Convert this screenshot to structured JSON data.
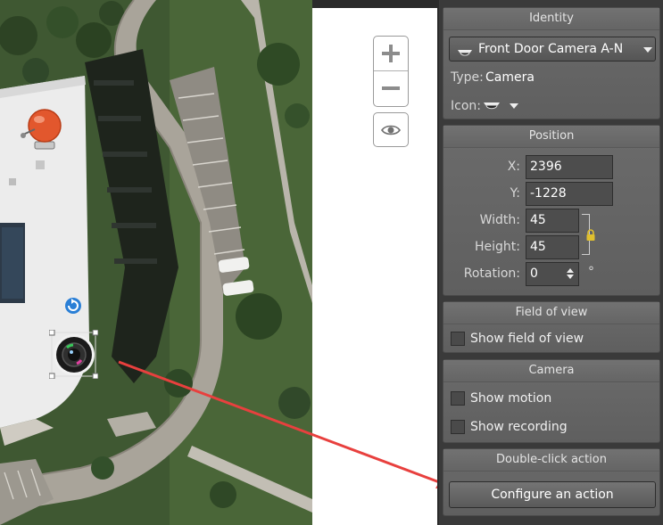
{
  "identity": {
    "title": "Identity",
    "selected_camera": "Front Door Camera A-N",
    "type_label": "Type:",
    "type_value": "Camera",
    "icon_label": "Icon:",
    "icon_name": "dome-camera-icon"
  },
  "position": {
    "title": "Position",
    "x_label": "X:",
    "x_value": "2396",
    "y_label": "Y:",
    "y_value": "-1228",
    "width_label": "Width:",
    "width_value": "45",
    "height_label": "Height:",
    "height_value": "45",
    "rotation_label": "Rotation:",
    "rotation_value": "0",
    "rotation_unit": "°"
  },
  "field_of_view": {
    "title": "Field of view",
    "show_label": "Show field of view",
    "checked": false
  },
  "camera": {
    "title": "Camera",
    "motion_label": "Show motion",
    "motion_checked": false,
    "recording_label": "Show recording",
    "recording_checked": false
  },
  "double_click": {
    "title": "Double-click action",
    "button_label": "Configure an action"
  },
  "map": {
    "zoom_in_icon": "plus-icon",
    "zoom_out_icon": "minus-icon",
    "visibility_icon": "eye-icon",
    "alarm_icon": "alarm-bell-icon",
    "camera_icon": "camera-lens-icon",
    "rotate_icon": "rotate-handle-icon"
  },
  "colors": {
    "annotation_arrow": "#e8403e",
    "panel_bg": "#3a3a3a",
    "section_bg": "#666666"
  }
}
